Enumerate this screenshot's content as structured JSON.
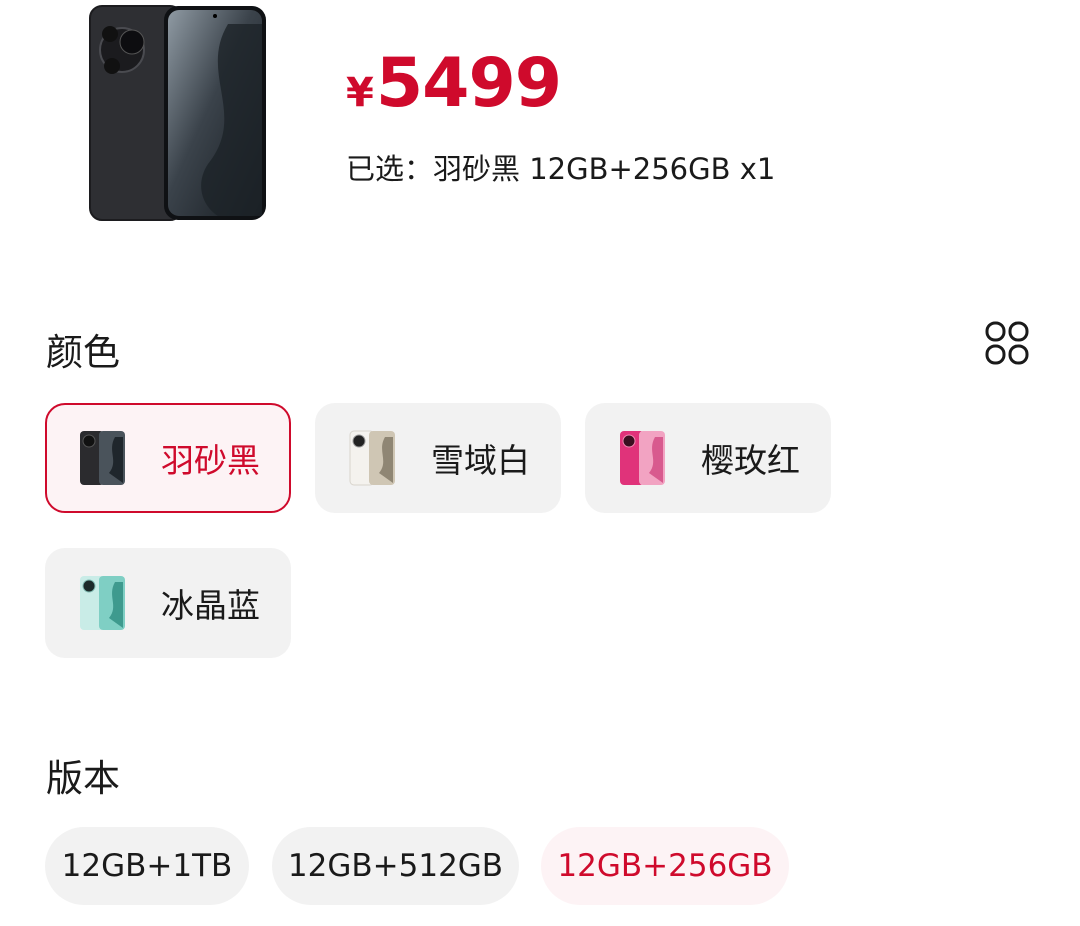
{
  "product": {
    "image_icon": "phone-product-image",
    "currency_symbol": "¥",
    "price": "5499",
    "selected_summary": "已选：羽砂黑 12GB+256GB x1"
  },
  "color_section": {
    "title": "颜色",
    "toggle_icon": "grid-view-icon",
    "options": [
      {
        "label": "羽砂黑",
        "selected": true,
        "swatch": "#2b2b2e"
      },
      {
        "label": "雪域白",
        "selected": false,
        "swatch": "#e8e4dc"
      },
      {
        "label": "樱玫红",
        "selected": false,
        "swatch": "#e0337a"
      },
      {
        "label": "冰晶蓝",
        "selected": false,
        "swatch": "#a6ddd6"
      }
    ]
  },
  "version_section": {
    "title": "版本",
    "options": [
      {
        "label": "12GB+1TB",
        "selected": false
      },
      {
        "label": "12GB+512GB",
        "selected": false
      },
      {
        "label": "12GB+256GB",
        "selected": true
      }
    ]
  },
  "colors": {
    "accent": "#cf0a2c",
    "chip_bg": "#f2f2f2",
    "selected_bg": "#fdf3f5"
  }
}
